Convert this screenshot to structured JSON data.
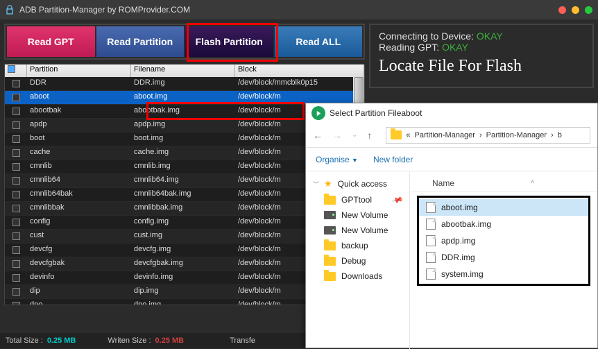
{
  "title": "ADB Partition-Manager by ROMProvider.COM",
  "buttons": {
    "read_gpt": "Read GPT",
    "read_partition": "Read Partition",
    "flash_partition": "Flash  Partition",
    "read_all": "Read ALL"
  },
  "status": {
    "line1_label": "Connecting to Device:",
    "line1_val": "OKAY",
    "line2_label": "Reading GPT:",
    "line2_val": "OKAY",
    "heading": "Locate File For Flash"
  },
  "table": {
    "headers": {
      "partition": "Partition",
      "filename": "Filename",
      "block": "Block"
    },
    "rows": [
      {
        "partition": "DDR",
        "filename": "DDR.img",
        "block": "/dev/block/mmcblk0p15"
      },
      {
        "partition": "aboot",
        "filename": "aboot.img",
        "block": "/dev/block/m"
      },
      {
        "partition": "abootbak",
        "filename": "abootbak.img",
        "block": "/dev/block/m"
      },
      {
        "partition": "apdp",
        "filename": "apdp.img",
        "block": "/dev/block/m"
      },
      {
        "partition": "boot",
        "filename": "boot.img",
        "block": "/dev/block/m"
      },
      {
        "partition": "cache",
        "filename": "cache.img",
        "block": "/dev/block/m"
      },
      {
        "partition": "cmnlib",
        "filename": "cmnlib.img",
        "block": "/dev/block/m"
      },
      {
        "partition": "cmnlib64",
        "filename": "cmnlib64.img",
        "block": "/dev/block/m"
      },
      {
        "partition": "cmnlib64bak",
        "filename": "cmnlib64bak.img",
        "block": "/dev/block/m"
      },
      {
        "partition": "cmnlibbak",
        "filename": "cmnlibbak.img",
        "block": "/dev/block/m"
      },
      {
        "partition": "config",
        "filename": "config.img",
        "block": "/dev/block/m"
      },
      {
        "partition": "cust",
        "filename": "cust.img",
        "block": "/dev/block/m"
      },
      {
        "partition": "devcfg",
        "filename": "devcfg.img",
        "block": "/dev/block/m"
      },
      {
        "partition": "devcfgbak",
        "filename": "devcfgbak.img",
        "block": "/dev/block/m"
      },
      {
        "partition": "devinfo",
        "filename": "devinfo.img",
        "block": "/dev/block/m"
      },
      {
        "partition": "dip",
        "filename": "dip.img",
        "block": "/dev/block/m"
      },
      {
        "partition": "dpo",
        "filename": "dpo.img",
        "block": "/dev/block/m"
      }
    ],
    "selected_index": 1
  },
  "footer": {
    "total_label": "Total Size :",
    "total_val": "0.25 MB",
    "writen_label": "Writen Size :",
    "writen_val": "0.25 MB",
    "transfer_label": "Transfe"
  },
  "dialog": {
    "title": "Select Partition Fileaboot",
    "crumbs": {
      "prefix": "«",
      "a": "Partition-Manager",
      "b": "Partition-Manager",
      "c": "b"
    },
    "organise": "Organise",
    "new_folder": "New folder",
    "name_header": "Name",
    "side": {
      "quick_access": "Quick access",
      "gpttool": "GPTtool",
      "nv1": "New Volume",
      "nv2": "New Volume",
      "backup": "backup",
      "debug": "Debug",
      "downloads": "Downloads"
    },
    "files": [
      "aboot.img",
      "abootbak.img",
      "apdp.img",
      "DDR.img",
      "system.img"
    ],
    "file_selected_index": 0
  }
}
